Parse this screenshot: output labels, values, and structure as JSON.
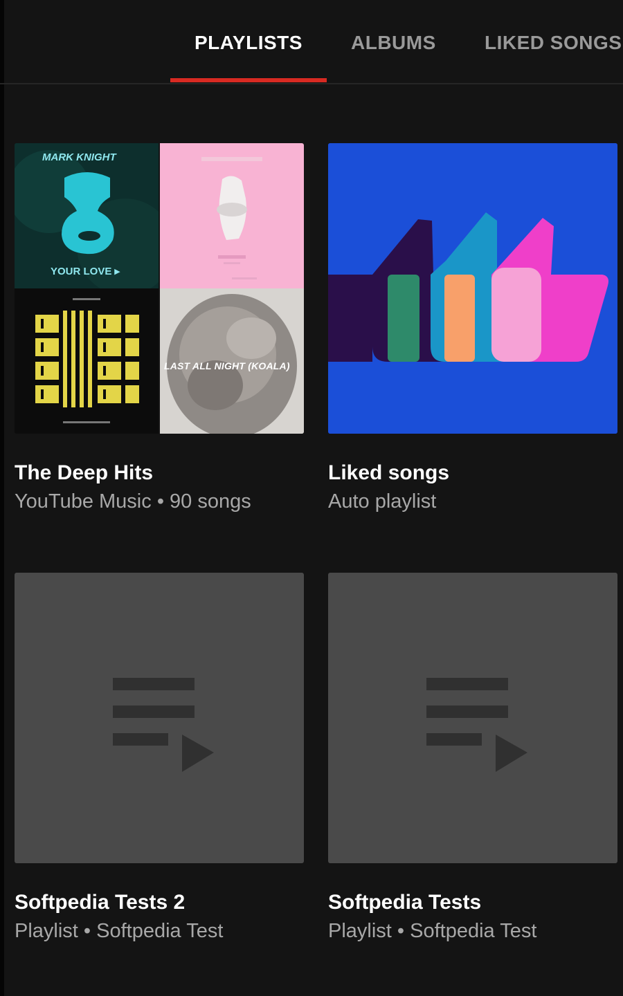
{
  "tabs": [
    {
      "label": "PLAYLISTS",
      "active": true
    },
    {
      "label": "ALBUMS",
      "active": false
    },
    {
      "label": "LIKED SONGS",
      "active": false
    }
  ],
  "colors": {
    "background": "#141414",
    "accent_red": "#d82a22",
    "placeholder_gray": "#4a4a4a",
    "liked_blue": "#1b4fd8"
  },
  "playlists": [
    {
      "title": "The Deep Hits",
      "subtitle_source": "YouTube Music",
      "subtitle_detail": "90 songs",
      "thumbnail": "album-art-mosaic",
      "mosaic": {
        "tile1_artist": "MARK KNIGHT",
        "tile1_track": "YOUR LOVE ▸",
        "tile4_text": "LAST ALL NIGHT (KOALA)"
      }
    },
    {
      "title": "Liked songs",
      "subtitle_source": "Auto playlist",
      "subtitle_detail": "",
      "thumbnail": "thumbs-up-art"
    },
    {
      "title": "Softpedia Tests 2",
      "subtitle_source": "Playlist",
      "subtitle_detail": "Softpedia Test",
      "thumbnail": "playlist-placeholder-icon"
    },
    {
      "title": "Softpedia Tests",
      "subtitle_source": "Playlist",
      "subtitle_detail": "Softpedia Test",
      "thumbnail": "playlist-placeholder-icon"
    }
  ],
  "separator": "•"
}
